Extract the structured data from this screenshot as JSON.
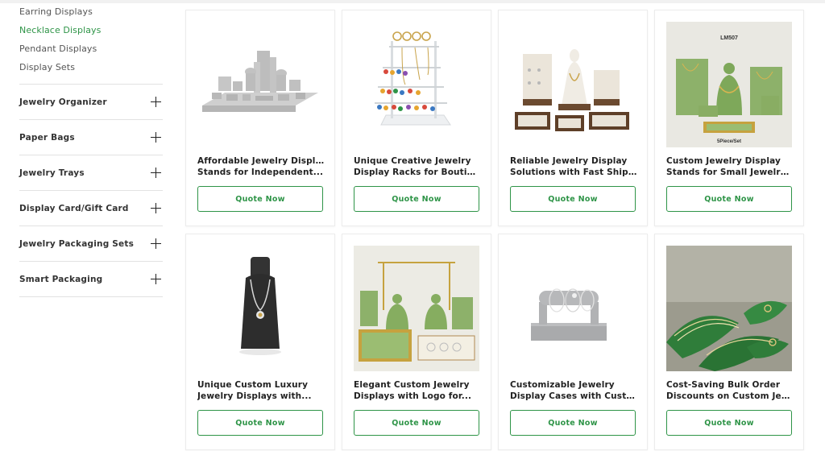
{
  "sidebar": {
    "sub_items": [
      {
        "label": "Earring Displays",
        "active": false
      },
      {
        "label": "Necklace Displays",
        "active": true
      },
      {
        "label": "Pendant Displays",
        "active": false
      },
      {
        "label": "Display Sets",
        "active": false
      }
    ],
    "categories": [
      {
        "label": "Jewelry Organizer"
      },
      {
        "label": "Paper Bags"
      },
      {
        "label": "Jewelry Trays"
      },
      {
        "label": "Display Card/Gift Card"
      },
      {
        "label": "Jewelry Packaging Sets"
      },
      {
        "label": "Smart Packaging"
      }
    ],
    "accent_color": "#2e9447"
  },
  "products": [
    {
      "title_line1": "Affordable Jewelry Display",
      "title_line2": "Stands for Independent...",
      "button": "Quote Now",
      "image": "grey-velvet-display-set"
    },
    {
      "title_line1": "Unique Creative Jewelry",
      "title_line2": "Display Racks for Boutique...",
      "button": "Quote Now",
      "image": "acrylic-earring-rack"
    },
    {
      "title_line1": "Reliable Jewelry Display",
      "title_line2": "Solutions with Fast Shippin...",
      "button": "Quote Now",
      "image": "walnut-display-set"
    },
    {
      "title_line1": "Custom Jewelry Display",
      "title_line2": "Stands for Small Jewelry...",
      "button": "Quote Now",
      "image": "green-display-set",
      "image_text_top": "LM507",
      "image_text_bottom": "5Piece/Set"
    },
    {
      "title_line1": "Unique Custom Luxury",
      "title_line2": "Jewelry Displays with...",
      "button": "Quote Now",
      "image": "black-necklace-bust"
    },
    {
      "title_line1": "Elegant Custom Jewelry",
      "title_line2": "Displays with Logo for...",
      "button": "Quote Now",
      "image": "green-bust-display-set"
    },
    {
      "title_line1": "Customizable Jewelry",
      "title_line2": "Display Cases with Custom...",
      "button": "Quote Now",
      "image": "grey-bracelet-bar"
    },
    {
      "title_line1": "Cost-Saving Bulk Order",
      "title_line2": "Discounts on Custom Jewel...",
      "button": "Quote Now",
      "image": "green-leaf-ring-holders"
    }
  ]
}
